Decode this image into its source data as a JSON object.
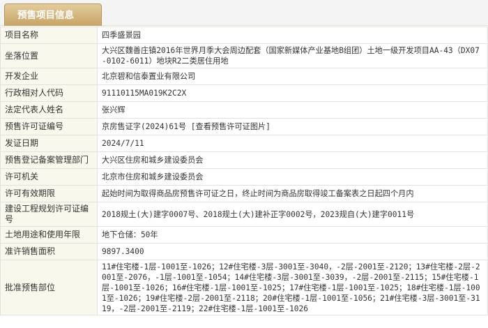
{
  "header": {
    "tab_title": "预售项目信息"
  },
  "rows": [
    {
      "label": "项目名称",
      "value": "四季盛景园"
    },
    {
      "label": "坐落位置",
      "value": "大兴区魏善庄镇2016年世界月季大会周边配套（国家新媒体产业基地B组团）土地一级开发项目AA-43（DX07-0102-6011）地块R2二类居住用地"
    },
    {
      "label": "开发企业",
      "value": "北京碧和信泰置业有限公司"
    },
    {
      "label": "行政相对人代码",
      "value": "91110115MA019K2C2X"
    },
    {
      "label": "法定代表人姓名",
      "value": "张兴辉"
    },
    {
      "label": "预售许可证编号",
      "value": "京房售证字(2024)61号",
      "link": "[查看预售许可证图片]"
    },
    {
      "label": "发证日期",
      "value": "2024/7/11"
    },
    {
      "label": "预售登记备案管理部门",
      "value": "大兴区住房和城乡建设委员会"
    },
    {
      "label": "许可机关",
      "value": "北京市住房和城乡建设委员会"
    },
    {
      "label": "许可有效期限",
      "value": "起始时间为取得商品房预售许可证之日，终止时间为商品房取得竣工备案表之日起四个月内"
    },
    {
      "label": "建设工程规划许可证编号",
      "value": "2018规土(大)建字0007号、2018规土(大)建补正字0002号，2023规自(大)建字0011号"
    },
    {
      "label": "土地用途和使用年限",
      "value": "地下仓储：50年"
    },
    {
      "label": "准许销售面积",
      "value": "9897.3400"
    },
    {
      "label": "批准预售部位",
      "value": "11#住宅楼-1层-1001至-1026；12#住宅楼-3层-3001至-3040，-2层-2001至-2120；13#住宅楼-2层-2001至-2076，-1层-1001至-1054；14#住宅楼-3层-3001至-3039，-2层-2001至-2115；15#住宅楼-1层-1001至-1026；16#住宅楼-1层-1001至-1025；17#住宅楼-1层-1001至-1025；18#住宅楼-1层-1001至-1026；19#住宅楼-2层-2001至-2118；20#住宅楼-1层-1001至-1056；21#住宅楼-3层-3001至-3119，-2层-2001至-2119；22#住宅楼-1层-1001至-1026"
    }
  ]
}
